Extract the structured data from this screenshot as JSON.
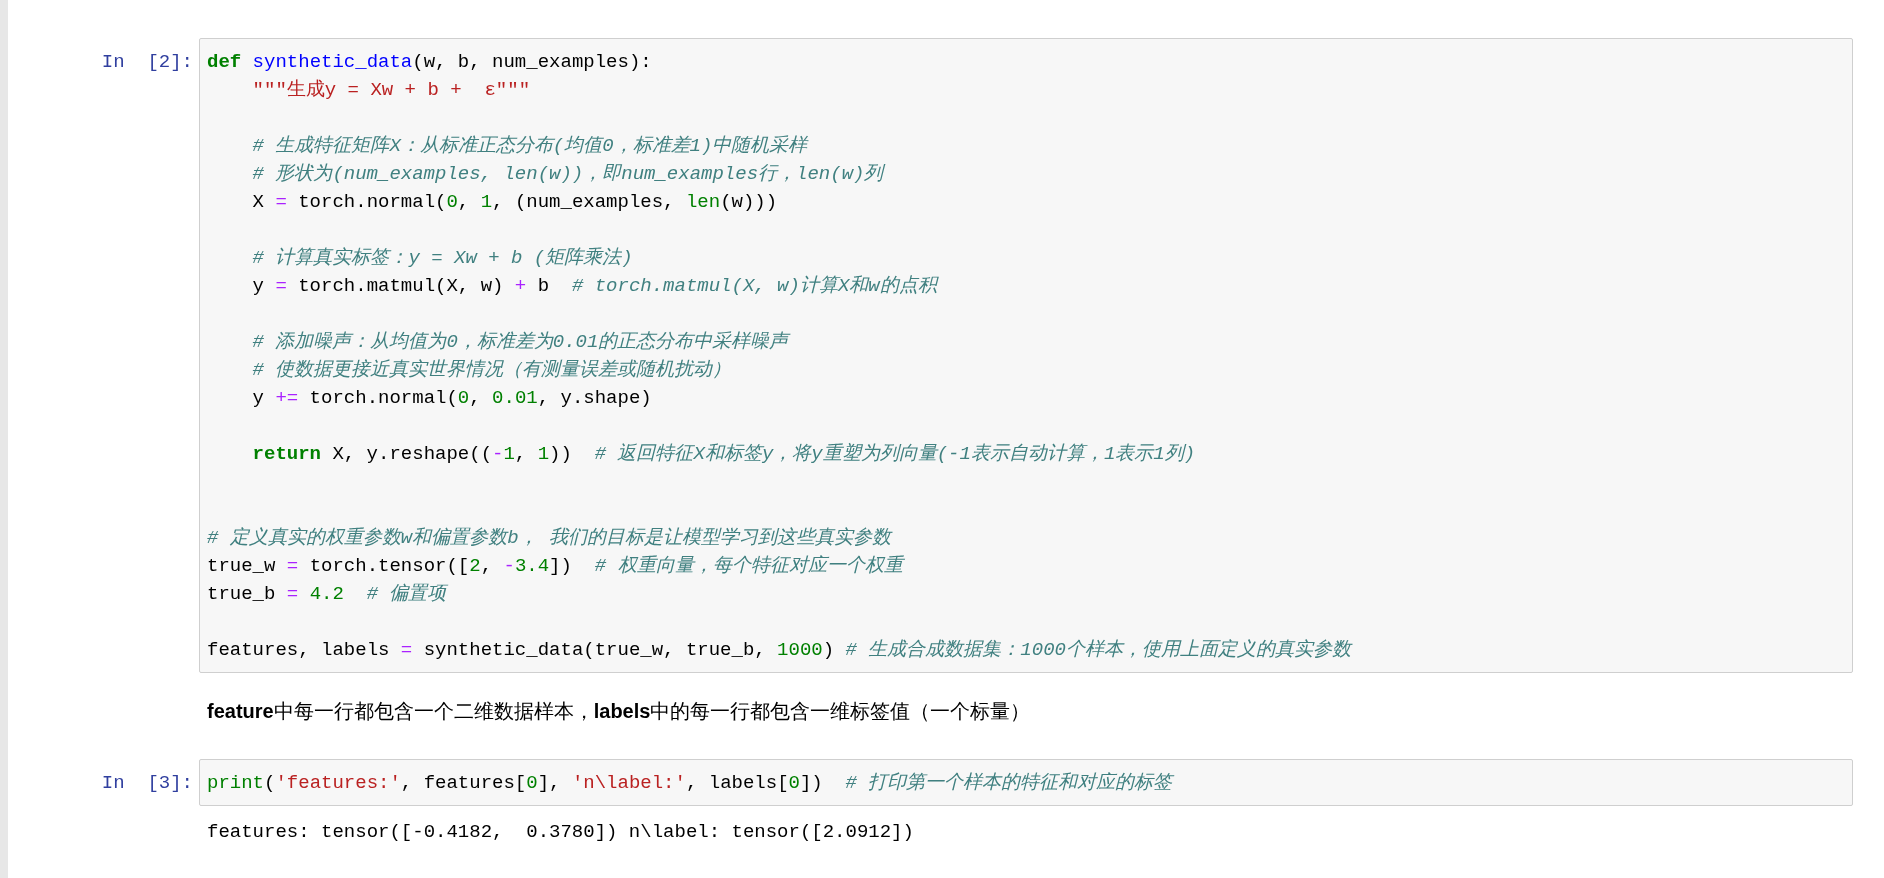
{
  "cells": [
    {
      "kind": "code",
      "prompt": "In  [2]:",
      "lines": [
        {
          "kind": "code",
          "indented": false,
          "tokens": [
            {
              "t": "def",
              "kind": "keyword"
            },
            {
              "t": " synthetic_data",
              "kind": "function"
            },
            {
              "t": "(w, b, num_examples):",
              "kind": "plain"
            }
          ]
        },
        {
          "kind": "code",
          "indented": true,
          "tokens": [
            {
              "t": "\"\"\"生成y = Xw + b +  ε\"\"\"",
              "kind": "string"
            }
          ]
        },
        {
          "kind": "blank"
        },
        {
          "kind": "code",
          "indented": true,
          "tokens": [
            {
              "t": "# 生成特征矩阵X：从标准正态分布(均值0，标准差1)中随机采样",
              "kind": "comment"
            }
          ]
        },
        {
          "kind": "code",
          "indented": true,
          "tokens": [
            {
              "t": "# 形状为(num_examples, len(w))，即num_examples行，len(w)列",
              "kind": "comment"
            }
          ]
        },
        {
          "kind": "code",
          "indented": true,
          "tokens": [
            {
              "t": "X ",
              "kind": "plain"
            },
            {
              "t": "=",
              "kind": "operator"
            },
            {
              "t": " torch.normal(",
              "kind": "plain"
            },
            {
              "t": "0",
              "kind": "number"
            },
            {
              "t": ", ",
              "kind": "plain"
            },
            {
              "t": "1",
              "kind": "number"
            },
            {
              "t": ", (num_examples, ",
              "kind": "plain"
            },
            {
              "t": "len",
              "kind": "builtin"
            },
            {
              "t": "(w)))",
              "kind": "plain"
            }
          ]
        },
        {
          "kind": "blank"
        },
        {
          "kind": "code",
          "indented": true,
          "tokens": [
            {
              "t": "# 计算真实标签：y = Xw + b (矩阵乘法)",
              "kind": "comment"
            }
          ]
        },
        {
          "kind": "code",
          "indented": true,
          "tokens": [
            {
              "t": "y ",
              "kind": "plain"
            },
            {
              "t": "=",
              "kind": "operator"
            },
            {
              "t": " torch.matmul(X, w) ",
              "kind": "plain"
            },
            {
              "t": "+",
              "kind": "operator"
            },
            {
              "t": " b  ",
              "kind": "plain"
            },
            {
              "t": "# torch.matmul(X, w)计算X和w的点积",
              "kind": "comment"
            }
          ]
        },
        {
          "kind": "blank"
        },
        {
          "kind": "code",
          "indented": true,
          "tokens": [
            {
              "t": "# 添加噪声：从均值为0，标准差为0.01的正态分布中采样噪声",
              "kind": "comment"
            }
          ]
        },
        {
          "kind": "code",
          "indented": true,
          "tokens": [
            {
              "t": "# 使数据更接近真实世界情况（有测量误差或随机扰动）",
              "kind": "comment"
            }
          ]
        },
        {
          "kind": "code",
          "indented": true,
          "tokens": [
            {
              "t": "y ",
              "kind": "plain"
            },
            {
              "t": "+=",
              "kind": "operator"
            },
            {
              "t": " torch.normal(",
              "kind": "plain"
            },
            {
              "t": "0",
              "kind": "number"
            },
            {
              "t": ", ",
              "kind": "plain"
            },
            {
              "t": "0.01",
              "kind": "number"
            },
            {
              "t": ", y.shape)",
              "kind": "plain"
            }
          ]
        },
        {
          "kind": "blank"
        },
        {
          "kind": "code",
          "indented": true,
          "tokens": [
            {
              "t": "return",
              "kind": "keyword"
            },
            {
              "t": " X, y.reshape((",
              "kind": "plain"
            },
            {
              "t": "-",
              "kind": "operator"
            },
            {
              "t": "1",
              "kind": "number"
            },
            {
              "t": ", ",
              "kind": "plain"
            },
            {
              "t": "1",
              "kind": "number"
            },
            {
              "t": "))  ",
              "kind": "plain"
            },
            {
              "t": "# 返回特征X和标签y，将y重塑为列向量(-1表示自动计算，1表示1列)",
              "kind": "comment"
            }
          ]
        },
        {
          "kind": "blank"
        },
        {
          "kind": "blank"
        },
        {
          "kind": "code",
          "indented": false,
          "tokens": [
            {
              "t": "# 定义真实的权重参数w和偏置参数b， 我们的目标是让模型学习到这些真实参数",
              "kind": "comment"
            }
          ]
        },
        {
          "kind": "code",
          "indented": false,
          "tokens": [
            {
              "t": "true_w ",
              "kind": "plain"
            },
            {
              "t": "=",
              "kind": "operator"
            },
            {
              "t": " torch.tensor([",
              "kind": "plain"
            },
            {
              "t": "2",
              "kind": "number"
            },
            {
              "t": ", ",
              "kind": "plain"
            },
            {
              "t": "-",
              "kind": "operator"
            },
            {
              "t": "3.4",
              "kind": "number"
            },
            {
              "t": "])  ",
              "kind": "plain"
            },
            {
              "t": "# 权重向量，每个特征对应一个权重",
              "kind": "comment"
            }
          ]
        },
        {
          "kind": "code",
          "indented": false,
          "tokens": [
            {
              "t": "true_b ",
              "kind": "plain"
            },
            {
              "t": "=",
              "kind": "operator"
            },
            {
              "t": " 4.2",
              "kind": "number"
            },
            {
              "t": "  # 偏置项",
              "kind": "comment"
            }
          ]
        },
        {
          "kind": "blank"
        },
        {
          "kind": "code",
          "indented": false,
          "tokens": [
            {
              "t": "features, labels ",
              "kind": "plain"
            },
            {
              "t": "=",
              "kind": "operator"
            },
            {
              "t": " synthetic_data(true_w, true_b, ",
              "kind": "plain"
            },
            {
              "t": "1000",
              "kind": "number"
            },
            {
              "t": ") ",
              "kind": "plain"
            },
            {
              "t": "# 生成合成数据集：1000个样本，使用上面定义的真实参数",
              "kind": "comment"
            }
          ]
        }
      ]
    },
    {
      "kind": "markdown",
      "text": "**feature**中每一行都包含一个二维数据样本，**labels**中的每一行都包含一维标签值（一个标量）"
    },
    {
      "kind": "code",
      "prompt": "In  [3]:",
      "lines": [
        {
          "kind": "code",
          "indented": false,
          "tokens": [
            {
              "t": "print",
              "kind": "builtin"
            },
            {
              "t": "(",
              "kind": "plain"
            },
            {
              "t": "'features:'",
              "kind": "string"
            },
            {
              "t": ", features[",
              "kind": "plain"
            },
            {
              "t": "0",
              "kind": "number"
            },
            {
              "t": "], ",
              "kind": "plain"
            },
            {
              "t": "'n\\label:'",
              "kind": "string"
            },
            {
              "t": ", labels[",
              "kind": "plain"
            },
            {
              "t": "0",
              "kind": "number"
            },
            {
              "t": "])  ",
              "kind": "plain"
            },
            {
              "t": "# 打印第一个样本的特征和对应的标签",
              "kind": "comment"
            }
          ]
        }
      ],
      "output": "features: tensor([-0.4182,  0.3780]) n\\label: tensor([2.0912])"
    }
  ]
}
